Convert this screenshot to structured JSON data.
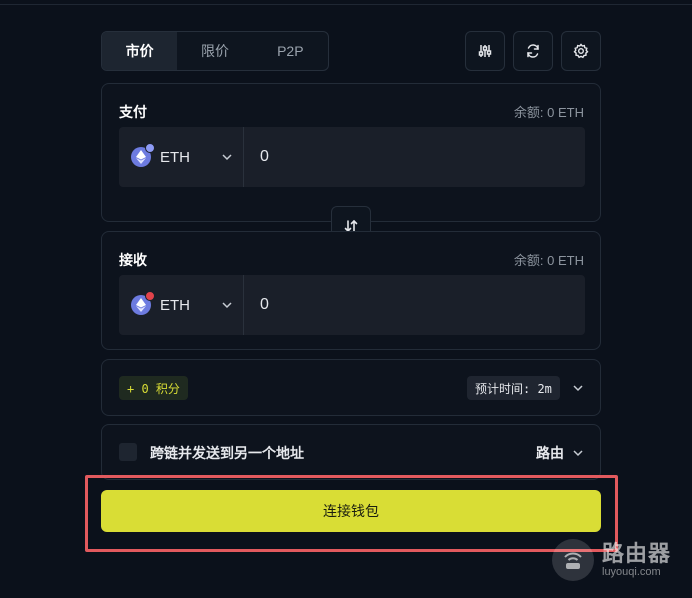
{
  "tabs": [
    {
      "label": "市价",
      "active": true
    },
    {
      "label": "限价",
      "active": false
    },
    {
      "label": "P2P",
      "active": false
    }
  ],
  "toolbar_icons": [
    "sliders-icon",
    "refresh-icon",
    "settings-gear-icon"
  ],
  "pay": {
    "title": "支付",
    "balance": "余额: 0  ETH",
    "token": "ETH",
    "amount": "0",
    "badge_color": "#8e9bf5"
  },
  "receive": {
    "title": "接收",
    "balance": "余额: 0 ETH",
    "token": "ETH",
    "amount": "0",
    "badge_color": "#e2434b"
  },
  "info": {
    "points": "+ 0 积分",
    "eta": "预计时间: 2m"
  },
  "cross_chain": {
    "label": "跨链并发送到另一个地址",
    "route_label": "路由"
  },
  "connect_button": "连接钱包",
  "watermark": {
    "cn": "路由器",
    "en": "luyouqi.com"
  },
  "colors": {
    "accent": "#d9dd35",
    "background": "#0b111b",
    "highlight_box": "#e25a5e"
  }
}
